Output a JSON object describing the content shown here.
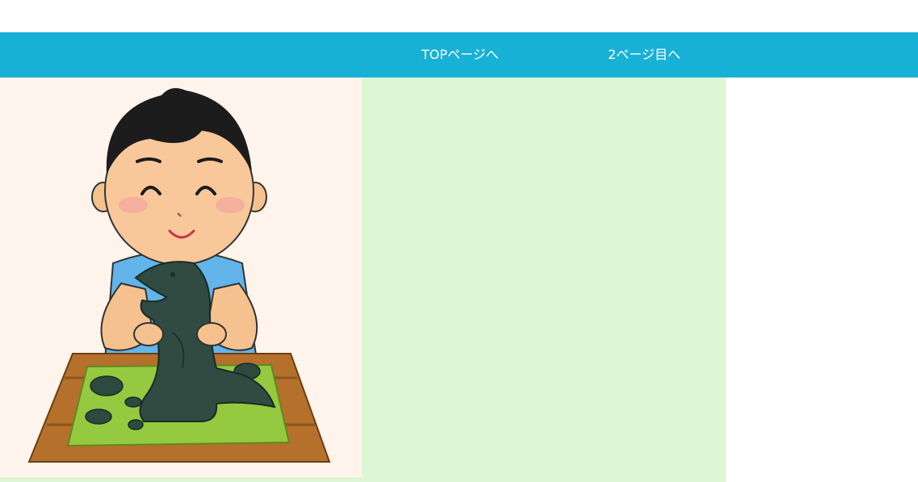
{
  "nav": {
    "links": [
      {
        "label": "TOPページへ"
      },
      {
        "label": "2ページ目へ"
      }
    ]
  },
  "colors": {
    "header_bg": "#18b1d6",
    "content_bg": "#dbf7d5",
    "image_bg": "#fef4ec",
    "page_bg": "#ffffff"
  },
  "image": {
    "icon": "boy-sculpting-clay-dinosaur-illustration"
  }
}
